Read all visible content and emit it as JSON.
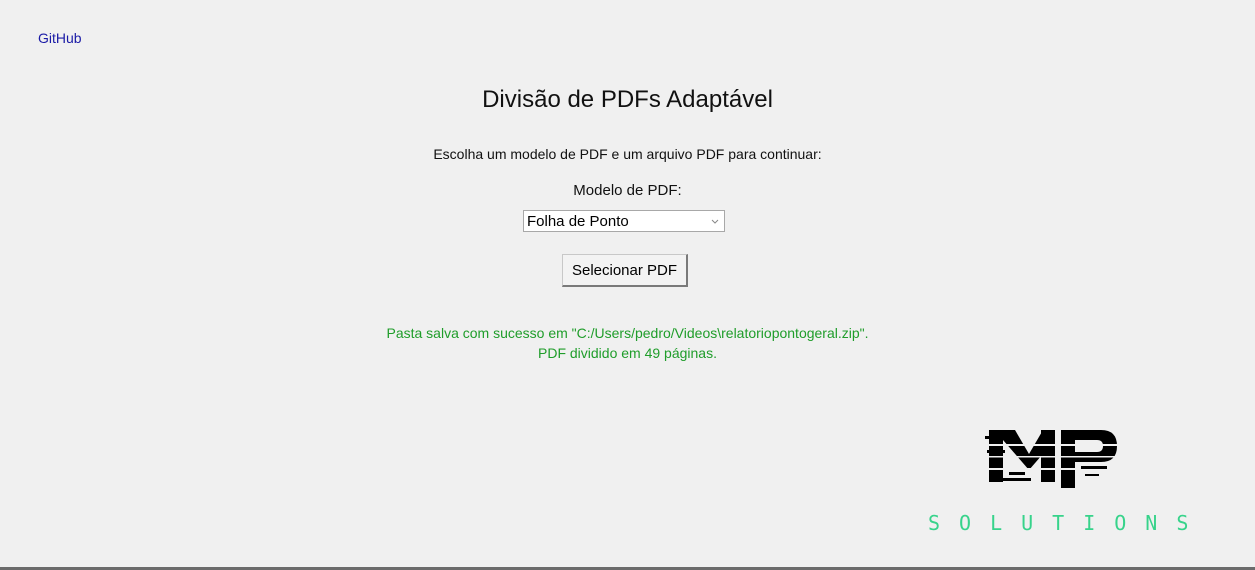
{
  "header": {
    "github_link": "GitHub"
  },
  "main": {
    "title": "Divisão de PDFs Adaptável",
    "instructions": "Escolha um modelo de PDF e um arquivo PDF para continuar:",
    "model_label": "Modelo de PDF:",
    "model_select": {
      "selected": "Folha de Ponto",
      "icon": "chevron-down-icon"
    },
    "select_button_label": "Selecionar PDF",
    "status": {
      "line1": "Pasta salva com sucesso em \"C:/Users/pedro/Videos\\relatoriopontogeral.zip\".",
      "line2": "PDF dividido em 49 páginas.",
      "color": "#1f9d2a"
    }
  },
  "logo": {
    "mark": "MP",
    "word": "SOLUTIONS",
    "word_color": "#37d38b"
  },
  "colors": {
    "background": "#f0f0f0",
    "link": "#1a1aa6"
  }
}
